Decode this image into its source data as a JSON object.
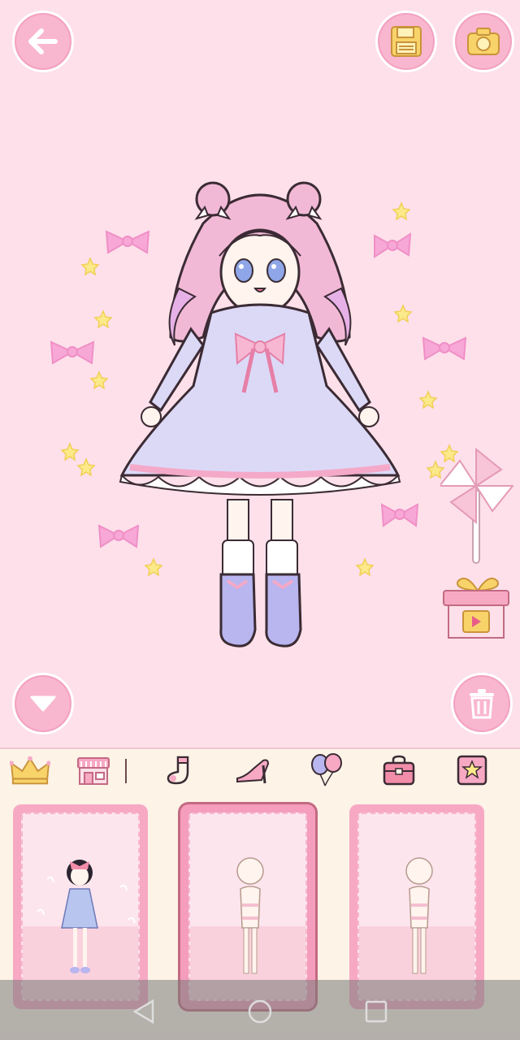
{
  "toolbar": {
    "back_icon": "arrow-left-icon",
    "save_icon": "floppy-disk-icon",
    "camera_icon": "camera-icon",
    "dropdown_icon": "chevron-down-icon",
    "trash_icon": "trash-icon"
  },
  "scene": {
    "character": "doll-in-lavender-dress",
    "props": [
      "pinwheel",
      "gift-video-box"
    ]
  },
  "categories": [
    {
      "icon": "crown-icon"
    },
    {
      "icon": "shop-icon"
    },
    {
      "icon": "sock-icon"
    },
    {
      "icon": "high-heel-icon"
    },
    {
      "icon": "balloons-icon"
    },
    {
      "icon": "bag-icon"
    },
    {
      "icon": "star-box-icon"
    }
  ],
  "cards": [
    {
      "name": "preset-girl-dress"
    },
    {
      "name": "blank-body"
    },
    {
      "name": "blank-body-2"
    }
  ],
  "colors": {
    "background": "#fde0ea",
    "button": "#f9b6cf",
    "accent": "#ef9db8",
    "dress": "#d9d8f5"
  }
}
